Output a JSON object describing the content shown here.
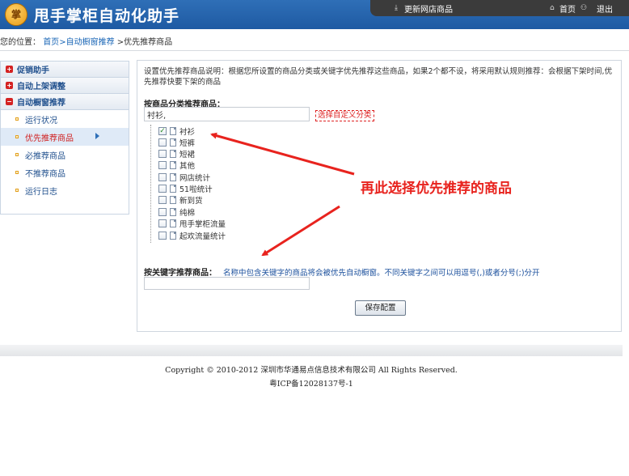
{
  "header": {
    "logo_text": "掌",
    "title": "甩手掌柜自动化助手",
    "update_label": "更新网店商品",
    "home_label": "首页",
    "logout_label": "退出"
  },
  "breadcrumb": {
    "prefix": "您的位置：",
    "link1": "首页",
    "link2": ">自动橱窗推荐",
    "current": " >优先推荐商品"
  },
  "sidebar": {
    "groups": [
      {
        "label": "促销助手"
      },
      {
        "label": "自动上架调整"
      },
      {
        "label": "自动橱窗推荐"
      }
    ],
    "items": [
      {
        "label": "运行状况"
      },
      {
        "label": "优先推荐商品"
      },
      {
        "label": "必推荐商品"
      },
      {
        "label": "不推荐商品"
      },
      {
        "label": "运行日志"
      }
    ]
  },
  "main": {
    "description": "设置优先推荐商品说明：根据您所设置的商品分类或关键字优先推荐这些商品，如果2个都不设，将采用默认规则推荐：会根据下架时间,优先推荐快要下架的商品",
    "category_section_label": "按商品分类推荐商品：",
    "category_input_value": "衬衫,",
    "custom_category_link": "选择自定义分类",
    "categories": [
      {
        "label": "衬衫",
        "checked": true
      },
      {
        "label": "短裤",
        "checked": false
      },
      {
        "label": "短裙",
        "checked": false
      },
      {
        "label": "其他",
        "checked": false
      },
      {
        "label": "网店统计",
        "checked": false
      },
      {
        "label": "51啦统计",
        "checked": false
      },
      {
        "label": "新到货",
        "checked": false
      },
      {
        "label": "纯棉",
        "checked": false
      },
      {
        "label": "甩手掌柜流量",
        "checked": false
      },
      {
        "label": "起欢流量统计",
        "checked": false
      }
    ],
    "keyword_section_label": "按关键字推荐商品：",
    "keyword_hint": "名称中包含关键字的商品将会被优先自动橱窗。不同关键字之间可以用逗号(,)或者分号(;)分开",
    "keyword_input_value": "",
    "save_button": "保存配置"
  },
  "annotation": {
    "text": "再此选择优先推荐的商品",
    "color": "#e8231e"
  },
  "footer": {
    "copyright": "Copyright © 2010-2012 深圳市华通易点信息技术有限公司  All Rights Reserved.",
    "icp": "粤ICP备12028137号-1"
  }
}
